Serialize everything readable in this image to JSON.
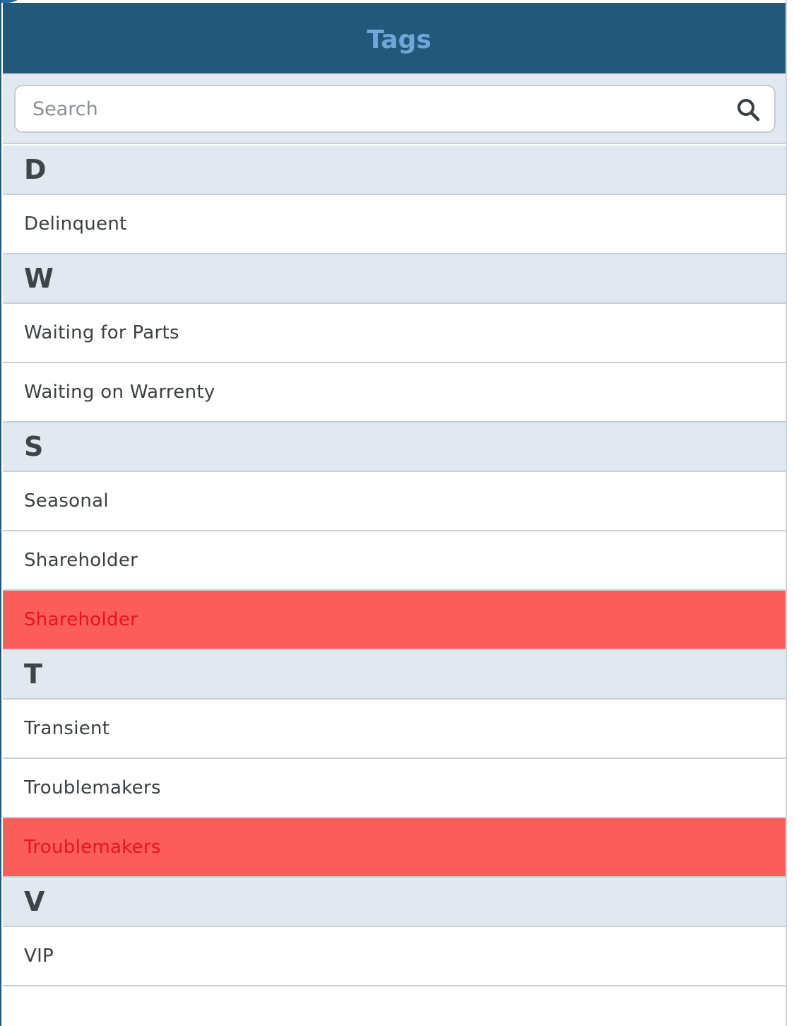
{
  "header": {
    "title": "Tags"
  },
  "search": {
    "placeholder": "Search",
    "value": ""
  },
  "sections": [
    {
      "letter": "D",
      "items": [
        {
          "label": "Delinquent",
          "flagged": false
        }
      ]
    },
    {
      "letter": "W",
      "items": [
        {
          "label": "Waiting for Parts",
          "flagged": false
        },
        {
          "label": "Waiting on Warrenty",
          "flagged": false
        }
      ]
    },
    {
      "letter": "S",
      "items": [
        {
          "label": "Seasonal",
          "flagged": false
        },
        {
          "label": "Shareholder",
          "flagged": false
        },
        {
          "label": "Shareholder",
          "flagged": true
        }
      ]
    },
    {
      "letter": "T",
      "items": [
        {
          "label": "Transient",
          "flagged": false
        },
        {
          "label": "Troublemakers",
          "flagged": false
        },
        {
          "label": "Troublemakers",
          "flagged": true
        }
      ]
    },
    {
      "letter": "V",
      "items": [
        {
          "label": "VIP",
          "flagged": false
        }
      ]
    }
  ],
  "colors": {
    "header_bg": "#22587a",
    "header_text": "#6fa8d6",
    "section_bg": "#e1e8ef",
    "flagged_bg": "#fb5d5d",
    "flagged_text": "#e8141f"
  },
  "icons": {
    "search": "search-icon"
  }
}
